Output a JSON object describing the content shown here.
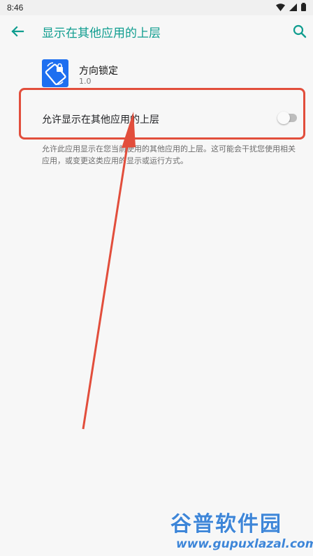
{
  "status_bar": {
    "time": "8:46"
  },
  "app_bar": {
    "title": "显示在其他应用的上层"
  },
  "app": {
    "name": "方向锁定",
    "version": "1.0"
  },
  "setting": {
    "label": "允许显示在其他应用的上层",
    "enabled": false,
    "description": "允许此应用显示在您当前使用的其他应用的上层。这可能会干扰您使用相关应用，或变更这类应用的显示或运行方式。"
  },
  "annotation": {
    "color": "#e24e3c"
  },
  "watermark": {
    "brand": "谷普软件园",
    "url": "www.gupuxlazal.com"
  },
  "colors": {
    "accent": "#0f9d8f",
    "app_icon": "#1e6ff0"
  }
}
